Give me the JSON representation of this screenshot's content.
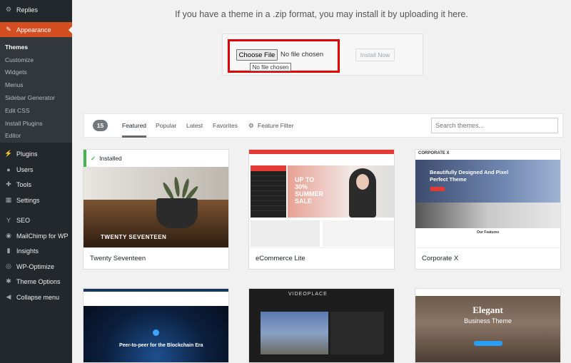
{
  "sidebar": {
    "top_item": "Replies",
    "active_item": "Appearance",
    "submenu": [
      "Themes",
      "Customize",
      "Widgets",
      "Menus",
      "Sidebar Generator",
      "Edit CSS",
      "Install Plugins",
      "Editor"
    ],
    "items": [
      "Plugins",
      "Users",
      "Tools",
      "Settings",
      "SEO",
      "MailChimp for WP",
      "Insights",
      "WP-Optimize",
      "Theme Options",
      "Collapse menu"
    ],
    "accent_color": "#d54e21"
  },
  "upload": {
    "message": "If you have a theme in a .zip format, you may install it by uploading it here.",
    "choose_label": "Choose File",
    "no_file": "No file chosen",
    "tooltip": "No file chosen",
    "install_label": "Install Now",
    "highlight_color": "#e00000"
  },
  "filters": {
    "count": "15",
    "tabs": [
      "Featured",
      "Popular",
      "Latest",
      "Favorites"
    ],
    "feature_filter": "Feature Filter",
    "search_placeholder": "Search themes..."
  },
  "themes": [
    {
      "name": "Twenty Seventeen",
      "installed_label": "Installed",
      "screenshot_title": "TWENTY SEVENTEEN"
    },
    {
      "name": "eCommerce Lite",
      "screenshot_sale": "UP TO 30% SUMMER SALE"
    },
    {
      "name": "Corporate X",
      "screenshot_logo": "CORPORATE X",
      "screenshot_heading": "Beautifully Designed And Pixel Perfect Theme",
      "screenshot_features": "Our Features"
    },
    {
      "screenshot_heading": "Peer-to-peer for the Blockchain Era"
    },
    {
      "screenshot_logo": "VIDEOPLACE"
    },
    {
      "screenshot_heading": "Elegant",
      "screenshot_sub": "Business Theme"
    }
  ]
}
